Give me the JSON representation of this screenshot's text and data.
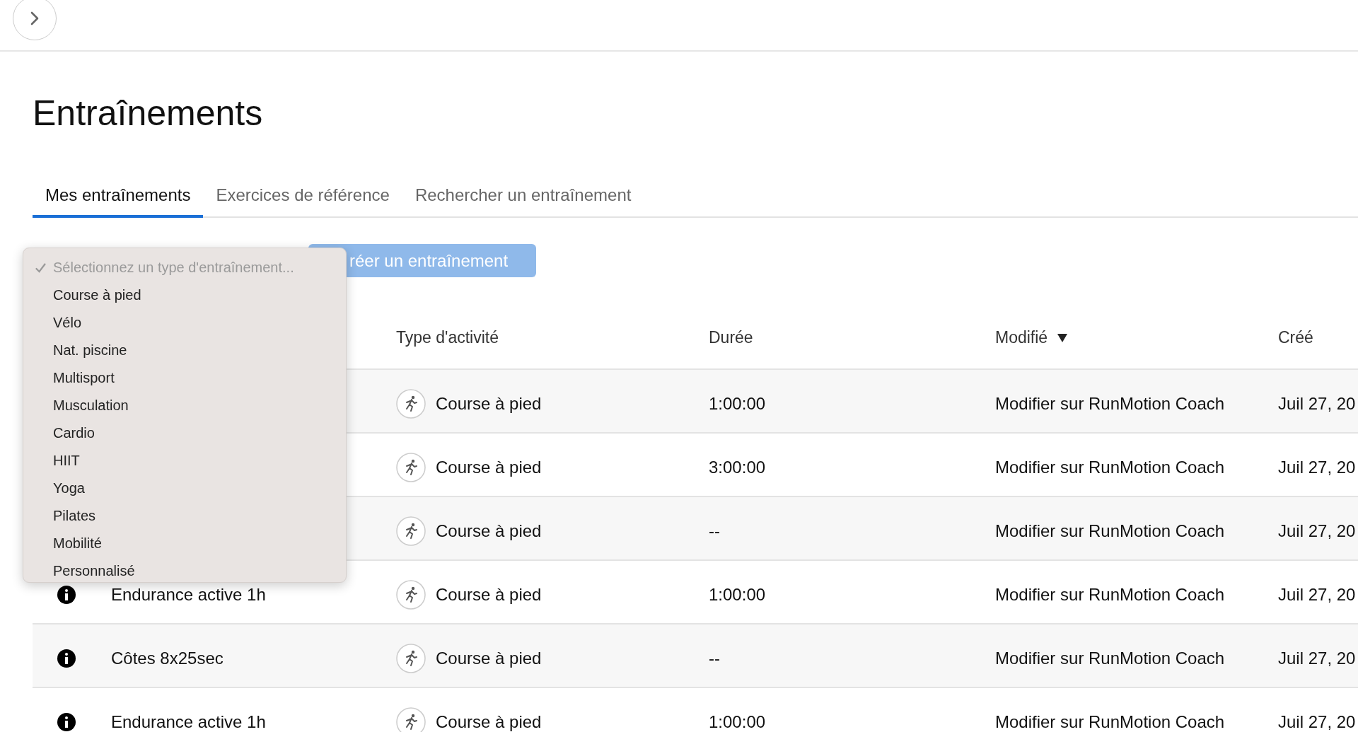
{
  "page": {
    "title": "Entraînements"
  },
  "tabs": [
    {
      "label": "Mes entraînements",
      "selected": true
    },
    {
      "label": "Exercices de référence",
      "selected": false
    },
    {
      "label": "Rechercher un entraînement",
      "selected": false
    }
  ],
  "create_button": {
    "label": "réer un entraînement"
  },
  "type_dropdown": {
    "options": [
      {
        "label": "Sélectionnez un type d'entraînement...",
        "selected": true
      },
      {
        "label": "Course à pied",
        "selected": false
      },
      {
        "label": "Vélo",
        "selected": false
      },
      {
        "label": "Nat. piscine",
        "selected": false
      },
      {
        "label": "Multisport",
        "selected": false
      },
      {
        "label": "Musculation",
        "selected": false
      },
      {
        "label": "Cardio",
        "selected": false
      },
      {
        "label": "HIIT",
        "selected": false
      },
      {
        "label": "Yoga",
        "selected": false
      },
      {
        "label": "Pilates",
        "selected": false
      },
      {
        "label": "Mobilité",
        "selected": false
      },
      {
        "label": "Personnalisé",
        "selected": false
      }
    ]
  },
  "table": {
    "columns": [
      {
        "label": "Type d'activité",
        "sorted": false
      },
      {
        "label": "Durée",
        "sorted": false
      },
      {
        "label": "Modifié",
        "sorted": true
      },
      {
        "label": "Créé",
        "sorted": false
      }
    ],
    "rows": [
      {
        "activity": "Course à pied",
        "duration": "1:00:00",
        "modified": "Modifier sur RunMotion Coach",
        "created": "Juil 27, 20"
      },
      {
        "activity": "Course à pied",
        "duration": "3:00:00",
        "modified": "Modifier sur RunMotion Coach",
        "created": "Juil 27, 20"
      },
      {
        "activity": "Course à pied",
        "duration": "--",
        "modified": "Modifier sur RunMotion Coach",
        "created": "Juil 27, 20"
      },
      {
        "name": "Endurance active 1h",
        "activity": "Course à pied",
        "duration": "1:00:00",
        "modified": "Modifier sur RunMotion Coach",
        "created": "Juil 27, 20"
      },
      {
        "name": "Côtes 8x25sec",
        "activity": "Course à pied",
        "duration": "--",
        "modified": "Modifier sur RunMotion Coach",
        "created": "Juil 27, 20"
      },
      {
        "name": "Endurance active 1h",
        "activity": "Course à pied",
        "duration": "1:00:00",
        "modified": "Modifier sur RunMotion Coach",
        "created": "Juil 27, 20"
      }
    ]
  }
}
